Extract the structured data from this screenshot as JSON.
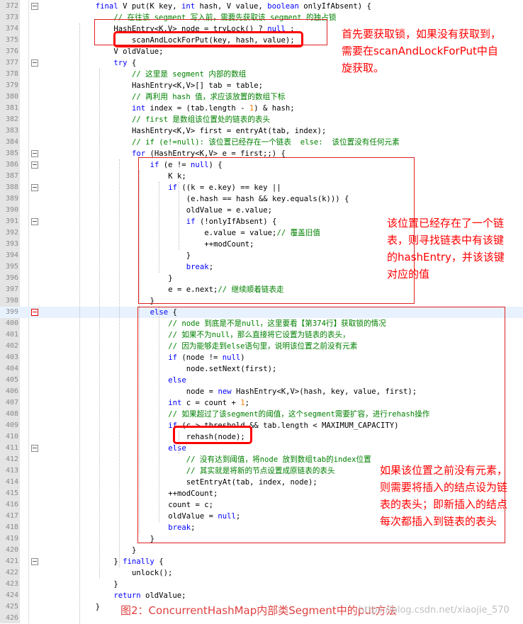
{
  "lines": [
    {
      "n": "372",
      "fold": true,
      "indent": 12,
      "parts": [
        {
          "t": "final",
          "c": "kw"
        },
        {
          "t": " V put(K key, "
        },
        {
          "t": "int",
          "c": "kw"
        },
        {
          "t": " hash, V value, "
        },
        {
          "t": "boolean",
          "c": "kw"
        },
        {
          "t": " onlyIfAbsent) {"
        }
      ]
    },
    {
      "n": "373",
      "indent": 16,
      "parts": [
        {
          "t": "// 在往该 segment 写入前，需要先获取该 segment 的独占锁",
          "c": "cm"
        }
      ]
    },
    {
      "n": "374",
      "indent": 16,
      "parts": [
        {
          "t": "HashEntry<K,V> node = tryLock() ? "
        },
        {
          "t": "null",
          "c": "kw"
        },
        {
          "t": " :"
        }
      ]
    },
    {
      "n": "375",
      "indent": 20,
      "parts": [
        {
          "t": "scanAndLockForPut(key, hash, value);"
        }
      ]
    },
    {
      "n": "376",
      "indent": 16,
      "parts": [
        {
          "t": "V oldValue;"
        }
      ]
    },
    {
      "n": "377",
      "fold": true,
      "indent": 16,
      "parts": [
        {
          "t": "try",
          "c": "kw"
        },
        {
          "t": " {"
        }
      ]
    },
    {
      "n": "378",
      "indent": 20,
      "parts": [
        {
          "t": "// 这里是 segment 内部的数组",
          "c": "cm"
        }
      ]
    },
    {
      "n": "379",
      "indent": 20,
      "parts": [
        {
          "t": "HashEntry<K,V>[] tab = table;"
        }
      ]
    },
    {
      "n": "380",
      "indent": 20,
      "parts": [
        {
          "t": "// 再利用 hash 值，求应该放置的数组下标",
          "c": "cm"
        }
      ]
    },
    {
      "n": "381",
      "indent": 20,
      "parts": [
        {
          "t": "int",
          "c": "kw"
        },
        {
          "t": " index = (tab.length - "
        },
        {
          "t": "1",
          "c": "nm"
        },
        {
          "t": ") & hash;"
        }
      ]
    },
    {
      "n": "382",
      "indent": 20,
      "parts": [
        {
          "t": "// first 是数组该位置处的链表的表头",
          "c": "cm"
        }
      ]
    },
    {
      "n": "383",
      "indent": 20,
      "parts": [
        {
          "t": "HashEntry<K,V> first = entryAt(tab, index);"
        }
      ]
    },
    {
      "n": "384",
      "indent": 20,
      "parts": [
        {
          "t": "// if (e!=null): 该位置已经存在一个链表  else:  该位置没有任何元素",
          "c": "cm"
        }
      ]
    },
    {
      "n": "385",
      "fold": true,
      "indent": 20,
      "parts": [
        {
          "t": "for",
          "c": "kw"
        },
        {
          "t": " (HashEntry<K,V> e = first;;) {"
        }
      ]
    },
    {
      "n": "386",
      "fold": true,
      "indent": 24,
      "parts": [
        {
          "t": "if",
          "c": "kw"
        },
        {
          "t": " (e != "
        },
        {
          "t": "null",
          "c": "kw"
        },
        {
          "t": ") {"
        }
      ]
    },
    {
      "n": "387",
      "indent": 28,
      "parts": [
        {
          "t": "K k;"
        }
      ]
    },
    {
      "n": "388",
      "fold": true,
      "indent": 28,
      "parts": [
        {
          "t": "if",
          "c": "kw"
        },
        {
          "t": " ((k = e.key) == key ||"
        }
      ]
    },
    {
      "n": "389",
      "indent": 32,
      "parts": [
        {
          "t": "(e.hash == hash && key.equals(k))) {"
        }
      ]
    },
    {
      "n": "390",
      "indent": 32,
      "parts": [
        {
          "t": "oldValue = e.value;"
        }
      ]
    },
    {
      "n": "391",
      "fold": true,
      "indent": 32,
      "parts": [
        {
          "t": "if",
          "c": "kw"
        },
        {
          "t": " (!onlyIfAbsent) {"
        }
      ]
    },
    {
      "n": "392",
      "indent": 36,
      "parts": [
        {
          "t": "e.value = value;"
        },
        {
          "t": "// 覆盖旧值",
          "c": "cm"
        }
      ]
    },
    {
      "n": "393",
      "indent": 36,
      "parts": [
        {
          "t": "++modCount;"
        }
      ]
    },
    {
      "n": "394",
      "indent": 32,
      "parts": [
        {
          "t": "}"
        }
      ]
    },
    {
      "n": "395",
      "indent": 32,
      "parts": [
        {
          "t": "break",
          "c": "kw"
        },
        {
          "t": ";"
        }
      ]
    },
    {
      "n": "396",
      "indent": 28,
      "parts": [
        {
          "t": "}"
        }
      ]
    },
    {
      "n": "397",
      "indent": 28,
      "parts": [
        {
          "t": "e = e.next;"
        },
        {
          "t": "// 继续顺着链表走",
          "c": "cm"
        }
      ]
    },
    {
      "n": "398",
      "indent": 24,
      "parts": [
        {
          "t": "}"
        }
      ]
    },
    {
      "n": "399",
      "fold": true,
      "active": true,
      "hl": true,
      "indent": 24,
      "parts": [
        {
          "t": "else",
          "c": "kw"
        },
        {
          "t": " {"
        }
      ]
    },
    {
      "n": "400",
      "indent": 28,
      "parts": [
        {
          "t": "// node 到底是不是null，这里要看【第374行】获取锁的情况",
          "c": "cm"
        }
      ]
    },
    {
      "n": "401",
      "indent": 28,
      "parts": [
        {
          "t": "// 如果不为null，那么直接将它设置为链表的表头，",
          "c": "cm"
        }
      ]
    },
    {
      "n": "402",
      "indent": 28,
      "parts": [
        {
          "t": "// 因为能够走到else语句里，说明该位置之前没有元素",
          "c": "cm"
        }
      ]
    },
    {
      "n": "403",
      "indent": 28,
      "parts": [
        {
          "t": "if",
          "c": "kw"
        },
        {
          "t": " (node != "
        },
        {
          "t": "null",
          "c": "kw"
        },
        {
          "t": ")"
        }
      ]
    },
    {
      "n": "404",
      "indent": 32,
      "parts": [
        {
          "t": "node.setNext(first);"
        }
      ]
    },
    {
      "n": "405",
      "indent": 28,
      "parts": [
        {
          "t": "else",
          "c": "kw"
        }
      ]
    },
    {
      "n": "406",
      "indent": 32,
      "parts": [
        {
          "t": "node = "
        },
        {
          "t": "new",
          "c": "kw"
        },
        {
          "t": " HashEntry<K,V>(hash, key, value, first);"
        }
      ]
    },
    {
      "n": "407",
      "indent": 28,
      "parts": [
        {
          "t": "int",
          "c": "kw"
        },
        {
          "t": " c = count + "
        },
        {
          "t": "1",
          "c": "nm"
        },
        {
          "t": ";"
        }
      ]
    },
    {
      "n": "408",
      "indent": 28,
      "parts": [
        {
          "t": "// 如果超过了该segment的阈值，这个segment需要扩容，进行rehash操作",
          "c": "cm"
        }
      ]
    },
    {
      "n": "409",
      "indent": 28,
      "parts": [
        {
          "t": "if",
          "c": "kw"
        },
        {
          "t": " (c > threshold && tab.length < MAXIMUM_CAPACITY)"
        }
      ]
    },
    {
      "n": "410",
      "indent": 32,
      "parts": [
        {
          "t": "rehash(node);"
        }
      ]
    },
    {
      "n": "411",
      "fold": true,
      "indent": 28,
      "parts": [
        {
          "t": "else",
          "c": "kw"
        }
      ]
    },
    {
      "n": "412",
      "indent": 32,
      "parts": [
        {
          "t": "// 没有达到阈值，将node 放到数组tab的index位置",
          "c": "cm"
        }
      ]
    },
    {
      "n": "413",
      "indent": 32,
      "parts": [
        {
          "t": "// 其实就是将新的节点设置成原链表的表头",
          "c": "cm"
        }
      ]
    },
    {
      "n": "414",
      "indent": 32,
      "parts": [
        {
          "t": "setEntryAt(tab, index, node);"
        }
      ]
    },
    {
      "n": "415",
      "indent": 28,
      "parts": [
        {
          "t": "++modCount;"
        }
      ]
    },
    {
      "n": "416",
      "indent": 28,
      "parts": [
        {
          "t": "count = c;"
        }
      ]
    },
    {
      "n": "417",
      "indent": 28,
      "parts": [
        {
          "t": "oldValue = "
        },
        {
          "t": "null",
          "c": "kw"
        },
        {
          "t": ";"
        }
      ]
    },
    {
      "n": "418",
      "indent": 28,
      "parts": [
        {
          "t": "break",
          "c": "kw"
        },
        {
          "t": ";"
        }
      ]
    },
    {
      "n": "419",
      "indent": 24,
      "parts": [
        {
          "t": "}"
        }
      ]
    },
    {
      "n": "420",
      "indent": 20,
      "parts": [
        {
          "t": "}"
        }
      ]
    },
    {
      "n": "421",
      "fold": true,
      "indent": 16,
      "parts": [
        {
          "t": "} "
        },
        {
          "t": "finally",
          "c": "kw"
        },
        {
          "t": " {"
        }
      ]
    },
    {
      "n": "422",
      "indent": 20,
      "parts": [
        {
          "t": "unlock();"
        }
      ]
    },
    {
      "n": "423",
      "indent": 16,
      "parts": [
        {
          "t": "}"
        }
      ]
    },
    {
      "n": "424",
      "indent": 16,
      "parts": [
        {
          "t": "return",
          "c": "kw"
        },
        {
          "t": " oldValue;"
        }
      ]
    },
    {
      "n": "425",
      "indent": 12,
      "parts": [
        {
          "t": "}"
        }
      ]
    },
    {
      "n": "426",
      "indent": 12,
      "parts": []
    }
  ],
  "annotations": {
    "lock": [
      "首先要获取锁，如果没有获取到，",
      "需要在scanAndLockForPut中自",
      "旋获取。"
    ],
    "exists": [
      "该位置已经存在了一个链",
      "表，则寻找链表中有该键",
      "的hashEntry，并该该键",
      "对应的值"
    ],
    "empty": [
      "如果该位置之前没有元素，",
      "则需要将插入的结点设为链",
      "表的表头；即新插入的结点",
      "每次都插入到链表的表头"
    ]
  },
  "caption": "图2：ConcurrentHashMap内部类Segment中的put方法",
  "watermark": "https://blog.csdn.net/xiaojie_570",
  "colors": {
    "keyword": "#0000ff",
    "comment": "#008000",
    "number": "#ff8000",
    "annotation": "#ff0000",
    "highlight": "#e8f2fe"
  }
}
